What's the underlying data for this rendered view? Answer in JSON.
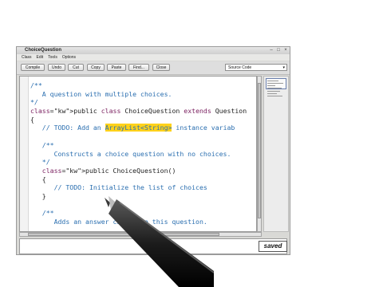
{
  "window": {
    "title": "ChoiceQuestion",
    "menu": [
      "Class",
      "Edit",
      "Tools",
      "Options"
    ]
  },
  "toolbar": {
    "buttons": [
      "Compile",
      "Undo",
      "Cut",
      "Copy",
      "Paste",
      "Find...",
      "Close"
    ],
    "view_select": "Source Code"
  },
  "code_lines": [
    "/**",
    "   A question with multiple choices.",
    "*/",
    "public class ChoiceQuestion extends Question",
    "{",
    "   // TODO: Add an ArrayList<String> instance variab",
    "",
    "   /**",
    "      Constructs a choice question with no choices.",
    "   */",
    "   public ChoiceQuestion()",
    "   {",
    "      // TODO: Initialize the list of choices",
    "   }",
    "",
    "   /**",
    "      Adds an answer choice to this question."
  ],
  "highlight_text": "ArrayList<String>",
  "status": {
    "saved": "saved"
  },
  "colors": {
    "keyword": "#7a1f5f",
    "comment": "#2b6fb0",
    "highlight": "#ffd21a"
  }
}
